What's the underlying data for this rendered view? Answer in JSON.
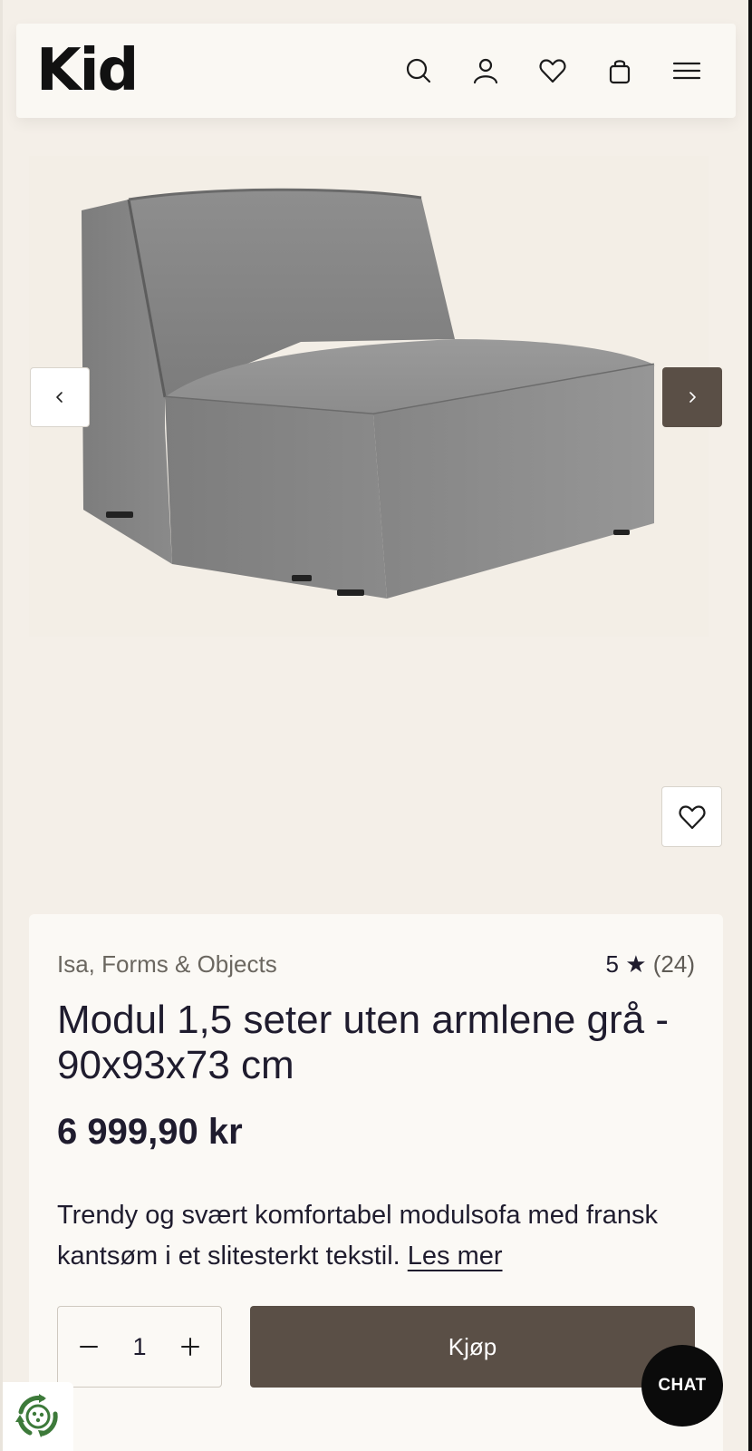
{
  "header": {
    "logo": "Kid",
    "icons": [
      "search-icon",
      "user-icon",
      "heart-icon",
      "bag-icon",
      "menu-icon"
    ]
  },
  "gallery": {
    "image_alt": "grey modular sofa seat",
    "prev_icon": "chevron-left-icon",
    "next_icon": "chevron-right-icon",
    "wishlist_icon": "heart-icon"
  },
  "product": {
    "brand": "Isa, Forms & Objects",
    "rating": "5 ★",
    "review_count": "(24)",
    "title": "Modul 1,5 seter uten armlene grå - 90x93x73 cm",
    "price": "6 999,90 kr",
    "description": "Trendy og svært komfortabel modulsofa med fransk kantsøm i et slitesterkt tekstil.",
    "read_more": "Les mer",
    "quantity": "1",
    "buy_label": "Kjøp"
  },
  "chat": {
    "label": "CHAT"
  },
  "colors": {
    "background": "#f4efe8",
    "card": "#fbf9f5",
    "accent_brown": "#5a4f46",
    "text": "#1f1c2e"
  }
}
